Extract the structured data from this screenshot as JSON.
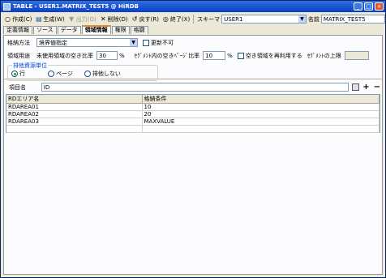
{
  "window": {
    "title": "TABLE - USER1.MATRIX_TEST5 @ HiRDB"
  },
  "toolbar": {
    "create_label": "作成(C)",
    "generate_label": "生成(W)",
    "output_label": "出力(O)",
    "delete_label": "削除(D)",
    "revert_label": "戻す(R)",
    "exit_label": "終了(X)",
    "schema_label": "スキーマ",
    "schema_value": "USER1",
    "name_label": "名前",
    "name_value": "MATRIX_TEST5"
  },
  "tabs": [
    "定義情報",
    "ソース",
    "データ",
    "領域情報",
    "権限",
    "格闘"
  ],
  "active_tab": 3,
  "form": {
    "storage_method_label": "格納方法",
    "storage_method_value": "境界値指定",
    "update_disable_label": "更新不可",
    "area_usage_label": "領域用途",
    "unused_free_ratio_label": "未使用領域の空き比率",
    "unused_free_ratio_value": "30",
    "percent1": "%",
    "segment_free_ratio_label": "ｾｸﾞﾒﾝﾄ内の空きﾍﾟｰｼﾞ比率",
    "segment_free_ratio_value": "10",
    "percent2": "%",
    "reuse_free_label": "空き領域を再利用する",
    "segment_upper_label": "ｾｸﾞﾒﾝﾄの上限",
    "segment_upper_value": "",
    "lock_group_label": "排他資源単位",
    "radio_row": "行",
    "radio_page": "ページ",
    "radio_none": "排他しない",
    "item_name_label": "項目名",
    "item_name_value": "ID"
  },
  "grid": {
    "columns": [
      "RDエリア名",
      "格納条件"
    ],
    "rows": [
      [
        "RDAREA01",
        "10"
      ],
      [
        "RDAREA02",
        "20"
      ],
      [
        "RDAREA03",
        "MAXVALUE"
      ]
    ]
  }
}
